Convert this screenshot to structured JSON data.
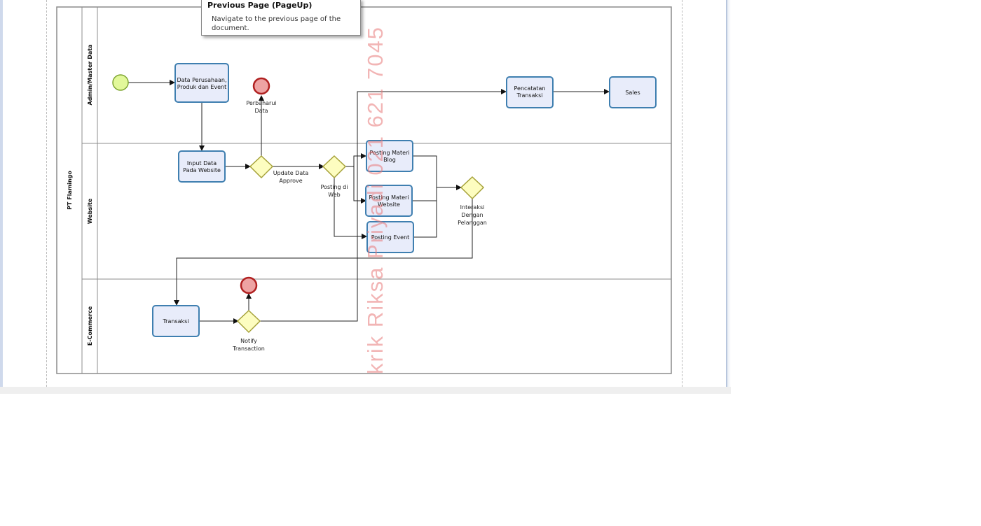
{
  "tooltip": {
    "title": "Previous Page (PageUp)",
    "description": "Navigate to the previous page of the document."
  },
  "diagram": {
    "pool_label": "PT Flamingo",
    "lanes": [
      "Admin/Master Data",
      "Website",
      "E-Commerce"
    ],
    "tasks": {
      "data_perusahaan": [
        "Data Perusahaan,",
        "Produk dan Event"
      ],
      "input_data": [
        "Input Data",
        "Pada Website"
      ],
      "posting_blog": [
        "Posting Materi",
        "Blog"
      ],
      "posting_website": [
        "Posting Materi",
        "Website"
      ],
      "posting_event": [
        "Posting Event"
      ],
      "pencatatan": [
        "Pencatatan",
        "Transaksi"
      ],
      "sales": [
        "Sales"
      ],
      "transaksi": [
        "Transaksi"
      ]
    },
    "labels": {
      "perbaharui": [
        "Perbaharui",
        "Data"
      ],
      "update_approve": [
        "Update Data",
        "Approve"
      ],
      "posting_web": [
        "Posting di",
        "Web"
      ],
      "interaksi": [
        "Interaksi",
        "Dengan",
        "Pelanggan"
      ],
      "notify": [
        "Notify",
        "Transaction"
      ]
    }
  },
  "watermark": "krik Riksa Priyadi 021 621 7045",
  "colors": {
    "task_fill": "#e8ecfa",
    "task_stroke": "#3f7fb0",
    "gateway_fill": "#fdfdc0",
    "gateway_stroke": "#a6a23a",
    "start_fill": "#e2f89a",
    "end_fill": "#eea3a3",
    "end_stroke": "#b02020",
    "watermark": "#e87878"
  }
}
